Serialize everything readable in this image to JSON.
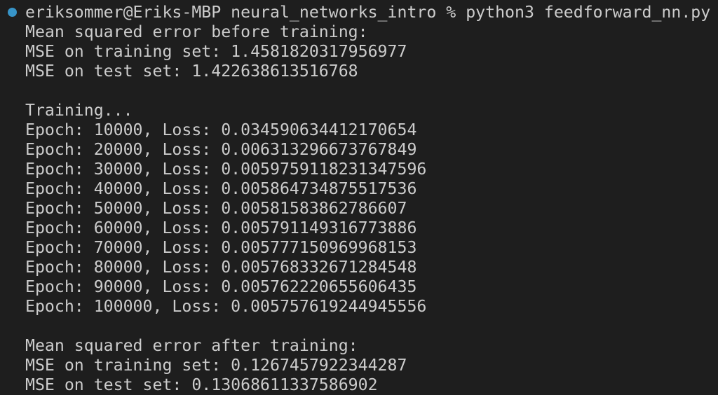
{
  "prompt": {
    "text": "eriksommer@Eriks-MBP neural_networks_intro % python3 feedforward_nn.py",
    "status_color": "#3794c8"
  },
  "before": {
    "heading": "Mean squared error before training:",
    "train": "MSE on training set: 1.4581820317956977",
    "test": "MSE on test set: 1.422638613516768"
  },
  "training": {
    "heading": "Training...",
    "epochs": [
      "Epoch: 10000, Loss: 0.034590634412170654",
      "Epoch: 20000, Loss: 0.006313296673767849",
      "Epoch: 30000, Loss: 0.0059759118231347596",
      "Epoch: 40000, Loss: 0.005864734875517536",
      "Epoch: 50000, Loss: 0.00581583862786607",
      "Epoch: 60000, Loss: 0.005791149316773886",
      "Epoch: 70000, Loss: 0.005777150969968153",
      "Epoch: 80000, Loss: 0.005768332671284548",
      "Epoch: 90000, Loss: 0.005762220655606435",
      "Epoch: 100000, Loss: 0.005757619244945556"
    ]
  },
  "after": {
    "heading": "Mean squared error after training:",
    "train": "MSE on training set: 0.1267457922344287",
    "test": "MSE on test set: 0.13068611337586902"
  }
}
